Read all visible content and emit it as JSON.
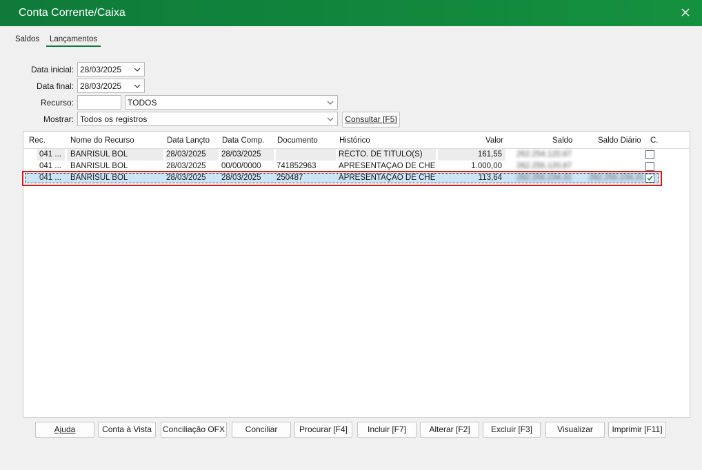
{
  "window": {
    "title": "Conta Corrente/Caixa"
  },
  "tabs": [
    {
      "label": "Saldos"
    },
    {
      "label": "Lançamentos"
    }
  ],
  "filters": {
    "data_inicial_label": "Data inicial:",
    "data_inicial_value": "28/03/2025",
    "data_final_label": "Data final:",
    "data_final_value": "28/03/2025",
    "recurso_label": "Recurso:",
    "recurso_code": "",
    "recurso_value": "TODOS",
    "mostrar_label": "Mostrar:",
    "mostrar_value": "Todos os registros",
    "consultar_label": "Consultar [F5]"
  },
  "grid": {
    "columns": [
      "Rec.",
      "Nome do Recurso",
      "Data Lançto",
      "Data Comp.",
      "Documento",
      "Histórico",
      "Valor",
      "Saldo",
      "Saldo Diário",
      "C."
    ],
    "rows": [
      {
        "rec": "041 ...",
        "nome": "BANRISUL BOL",
        "data_lancto": "28/03/2025",
        "data_comp": "28/03/2025",
        "documento": "",
        "historico": "RECTO. DE TÍTULO(S)",
        "valor": "161,55",
        "saldo": "262.254.120,67",
        "saldo_diario": "",
        "conciliado": false
      },
      {
        "rec": "041 ...",
        "nome": "BANRISUL BOL",
        "data_lancto": "28/03/2025",
        "data_comp": "00/00/0000",
        "documento": "741852963",
        "historico": "APRESENTAÇÃO DE CHE...",
        "valor": "1.000,00",
        "saldo": "262.255.120,67",
        "saldo_diario": "",
        "conciliado": false
      },
      {
        "rec": "041 ...",
        "nome": "BANRISUL BOL",
        "data_lancto": "28/03/2025",
        "data_comp": "28/03/2025",
        "documento": "250487",
        "historico": "APRESENTAÇÃO DE CHE...",
        "valor": "113,64",
        "saldo": "262.255.234,31",
        "saldo_diario": "262.255.234,31",
        "conciliado": true
      }
    ]
  },
  "buttons": {
    "ajuda": "Ajuda",
    "conta_vista": "Conta à Vista",
    "conciliacao_ofx": "Conciliação OFX",
    "conciliar": "Conciliar",
    "procurar": "Procurar [F4]",
    "incluir": "Incluir [F7]",
    "alterar": "Alterar [F2]",
    "excluir": "Excluir [F3]",
    "visualizar": "Visualizar",
    "imprimir": "Imprimir [F11]"
  },
  "colors": {
    "title_green": "#0f7a3a",
    "selection": "#cce4f7",
    "highlight_red": "#d11a1a"
  }
}
